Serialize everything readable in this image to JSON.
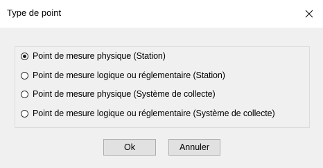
{
  "window": {
    "title": "Type de point",
    "close_icon": "close-icon"
  },
  "options": {
    "items": [
      {
        "label": "Point de mesure physique (Station)",
        "selected": true
      },
      {
        "label": "Point de mesure logique ou réglementaire (Station)",
        "selected": false
      },
      {
        "label": "Point de mesure physique (Système de collecte)",
        "selected": false
      },
      {
        "label": "Point de mesure logique ou réglementaire (Système de collecte)",
        "selected": false
      }
    ]
  },
  "buttons": {
    "ok_label": "Ok",
    "cancel_label": "Annuler"
  },
  "colors": {
    "dialog_background": "#f0f0f0",
    "titlebar_background": "#ffffff",
    "button_background": "#e1e1e1",
    "button_border": "#adadad"
  }
}
